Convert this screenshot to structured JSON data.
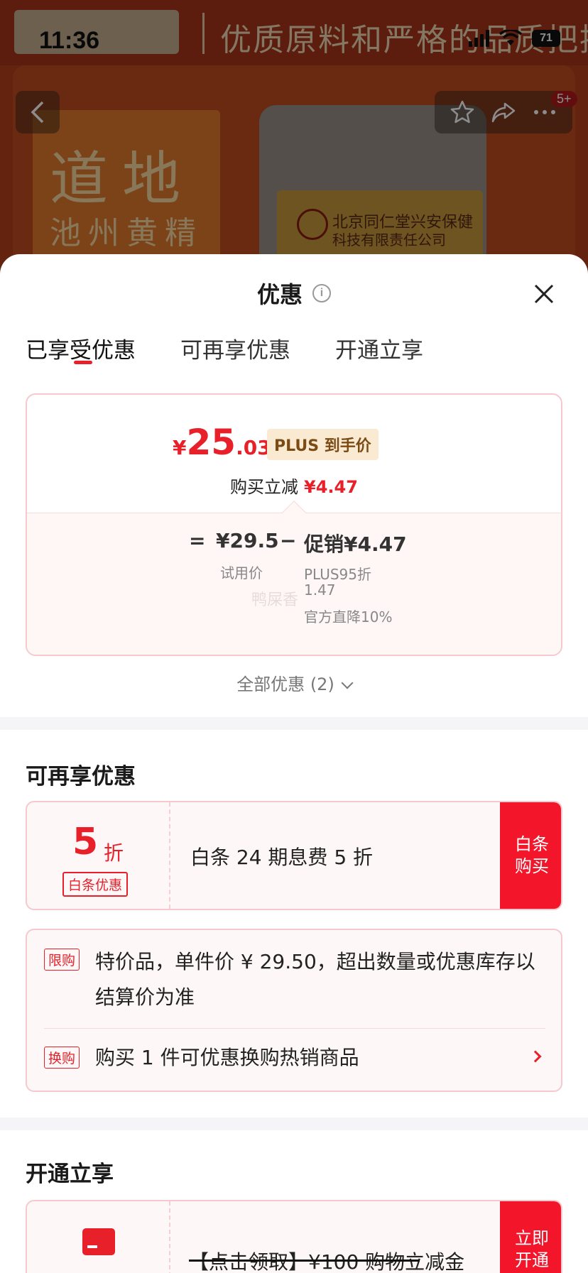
{
  "status_bar": {
    "time": "11:36",
    "battery": "71"
  },
  "background": {
    "banner_text": "优质原料和严格的品质把控",
    "tile_big": "道地",
    "tile_small": "池州黄精",
    "jar_text_1": "北京同仁堂兴安保健",
    "jar_text_2": "科技有限责任公司",
    "cart_badge": "5+"
  },
  "sheet": {
    "title": "优惠",
    "tabs": [
      "已享受优惠",
      "可再享优惠",
      "开通立享"
    ],
    "summary": {
      "price_symbol": "¥",
      "price_integer": "25",
      "price_decimal": ".03",
      "plus_tag": "PLUS 到手价",
      "reduce_label": "购买立减",
      "reduce_value": "¥4.47",
      "equals": "=",
      "base_price": "¥29.5",
      "base_label": "试用价",
      "minus": "−",
      "promo": "促销¥4.47",
      "promo_line1": "PLUS95折",
      "promo_line2": "1.47",
      "promo_line3": "官方直降10%",
      "watermark": "鸭屎香"
    },
    "all_offers": "全部优惠 (2)",
    "section_more": "可再享优惠",
    "baitiao": {
      "number": "5",
      "unit": "折",
      "tag": "白条优惠",
      "text": "白条 24 期息费 5 折",
      "button_line1": "白条",
      "button_line2": "购买"
    },
    "restriction": {
      "tag1": "限购",
      "text1": "特价品，单件价 ¥ 29.50，超出数量或优惠库存以结算价为准",
      "tag2": "换购",
      "text2": "购买 1 件可优惠换购热销商品"
    },
    "section_open": "开通立享",
    "open": {
      "text": "【点击领取】¥100 购物立减金",
      "button_line1": "立即",
      "button_line2": "开通"
    }
  }
}
